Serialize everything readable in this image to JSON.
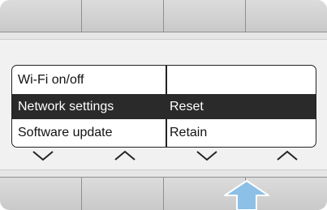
{
  "menu": {
    "rows": [
      {
        "left": "Wi-Fi on/off",
        "right": "",
        "selected": false
      },
      {
        "left": "Network settings",
        "right": "Reset",
        "selected": true
      },
      {
        "left": "Software update",
        "right": "Retain",
        "selected": false
      }
    ]
  },
  "soft_keys": [
    {
      "icon": "chevron-down-icon"
    },
    {
      "icon": "chevron-up-icon"
    },
    {
      "icon": "chevron-down-icon"
    },
    {
      "icon": "chevron-up-icon"
    }
  ],
  "pointer": {
    "icon": "arrow-up-icon",
    "target": "bottom-button-3"
  },
  "colors": {
    "device_background": "#e6e6e6",
    "button_face": "#d2d2d2",
    "selected_row": "#2a2a2a",
    "pointer_arrow": "#8cc0e6"
  }
}
